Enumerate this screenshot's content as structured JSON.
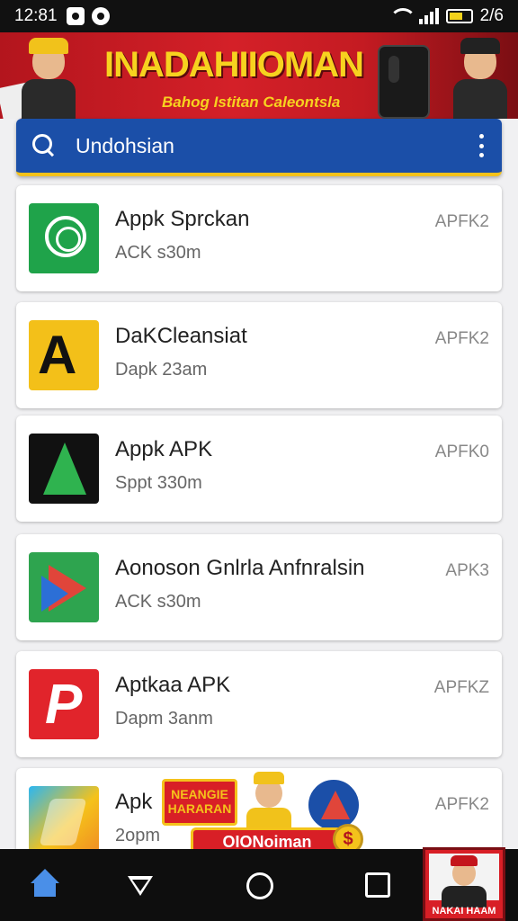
{
  "status_bar": {
    "time": "12:81",
    "battery_text": "2/6"
  },
  "banner": {
    "title": "INADAHIIOMAN",
    "subtitle": "Bahog Istitan Caleontsla"
  },
  "search": {
    "query": "Undohsian"
  },
  "apps": [
    {
      "name": "Appk Sprckan",
      "subtitle": "ACK s30m",
      "tag": "APFK2",
      "icon": "app-icon-green"
    },
    {
      "name": "DaKCleansiat",
      "subtitle": "Dapk 23am",
      "tag": "APFK2",
      "icon": "app-icon-yellow-a"
    },
    {
      "name": "Appk APK",
      "subtitle": "Sppt 330m",
      "tag": "APFK0",
      "icon": "app-icon-black-green"
    },
    {
      "name": "Aonoson Gnlrla Anfnralsin",
      "subtitle": "ACK s30m",
      "tag": "APK3",
      "icon": "app-icon-play"
    },
    {
      "name": "Aptkaa APK",
      "subtitle": "Dapm 3anm",
      "tag": "APFKZ",
      "icon": "app-icon-red-p"
    },
    {
      "name": "Apk",
      "subtitle": "2opm",
      "tag": "APFK2",
      "icon": "app-icon-multicolor"
    }
  ],
  "overlay_ad": {
    "left_text": "NEANGIE HARARAN",
    "pill_text": "OIONoiman",
    "coin_text": "$"
  },
  "corner_ad": {
    "label": "NAKAI HAAM"
  },
  "colors": {
    "banner_red": "#d42028",
    "banner_yellow": "#f7d21f",
    "search_blue": "#1b4fa8",
    "nav_active": "#4a8fe8"
  }
}
